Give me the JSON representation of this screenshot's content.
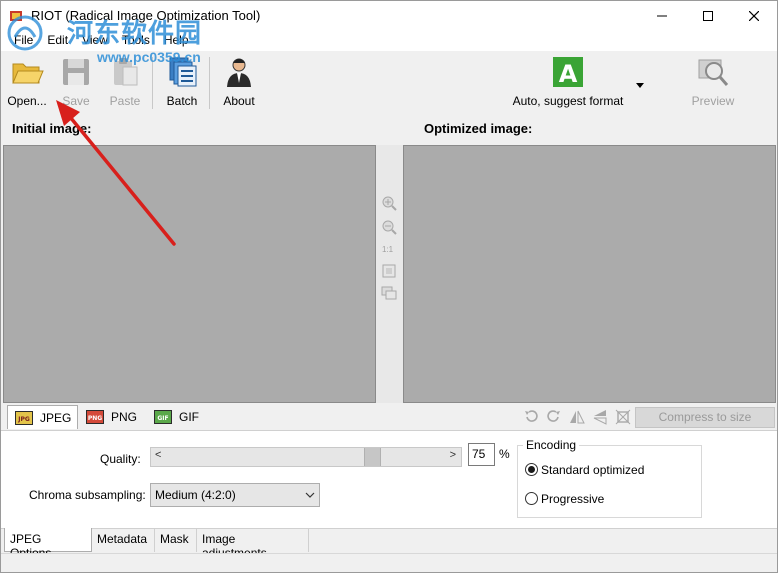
{
  "window": {
    "title": "RIOT (Radical Image Optimization Tool)"
  },
  "menu": {
    "items": [
      "File",
      "Edit",
      "View",
      "Tools",
      "Help"
    ]
  },
  "watermark": {
    "text": "河东软件园",
    "url": "www.pc0359.cn"
  },
  "toolbar": {
    "open_label": "Open...",
    "save_label": "Save",
    "paste_label": "Paste",
    "batch_label": "Batch",
    "about_label": "About",
    "format_label": "Auto, suggest format",
    "format_letter": "A",
    "preview_label": "Preview"
  },
  "panels": {
    "initial_label": "Initial image:",
    "optimized_label": "Optimized image:"
  },
  "zoom_tools": {
    "one_to_one": "1:1"
  },
  "format_tabs": {
    "jpeg": "JPEG",
    "png": "PNG",
    "gif": "GIF",
    "jpeg_icon_text": "JPG",
    "png_icon_text": "PNG",
    "gif_icon_text": "GIF",
    "compress_label": "Compress to size"
  },
  "options": {
    "quality_label": "Quality:",
    "quality_value": "75",
    "quality_percent": 75,
    "percent_sign": "%",
    "chroma_label": "Chroma subsampling:",
    "chroma_value": "Medium (4:2:0)",
    "encoding_title": "Encoding",
    "standard_label": "Standard optimized",
    "progressive_label": "Progressive"
  },
  "bottom_tabs": [
    "JPEG Options",
    "Metadata",
    "Mask",
    "Image adjustments"
  ],
  "colors": {
    "accent_green": "#3aa435",
    "annotation_red": "#d8201c",
    "panel_gray": "#ababab"
  }
}
